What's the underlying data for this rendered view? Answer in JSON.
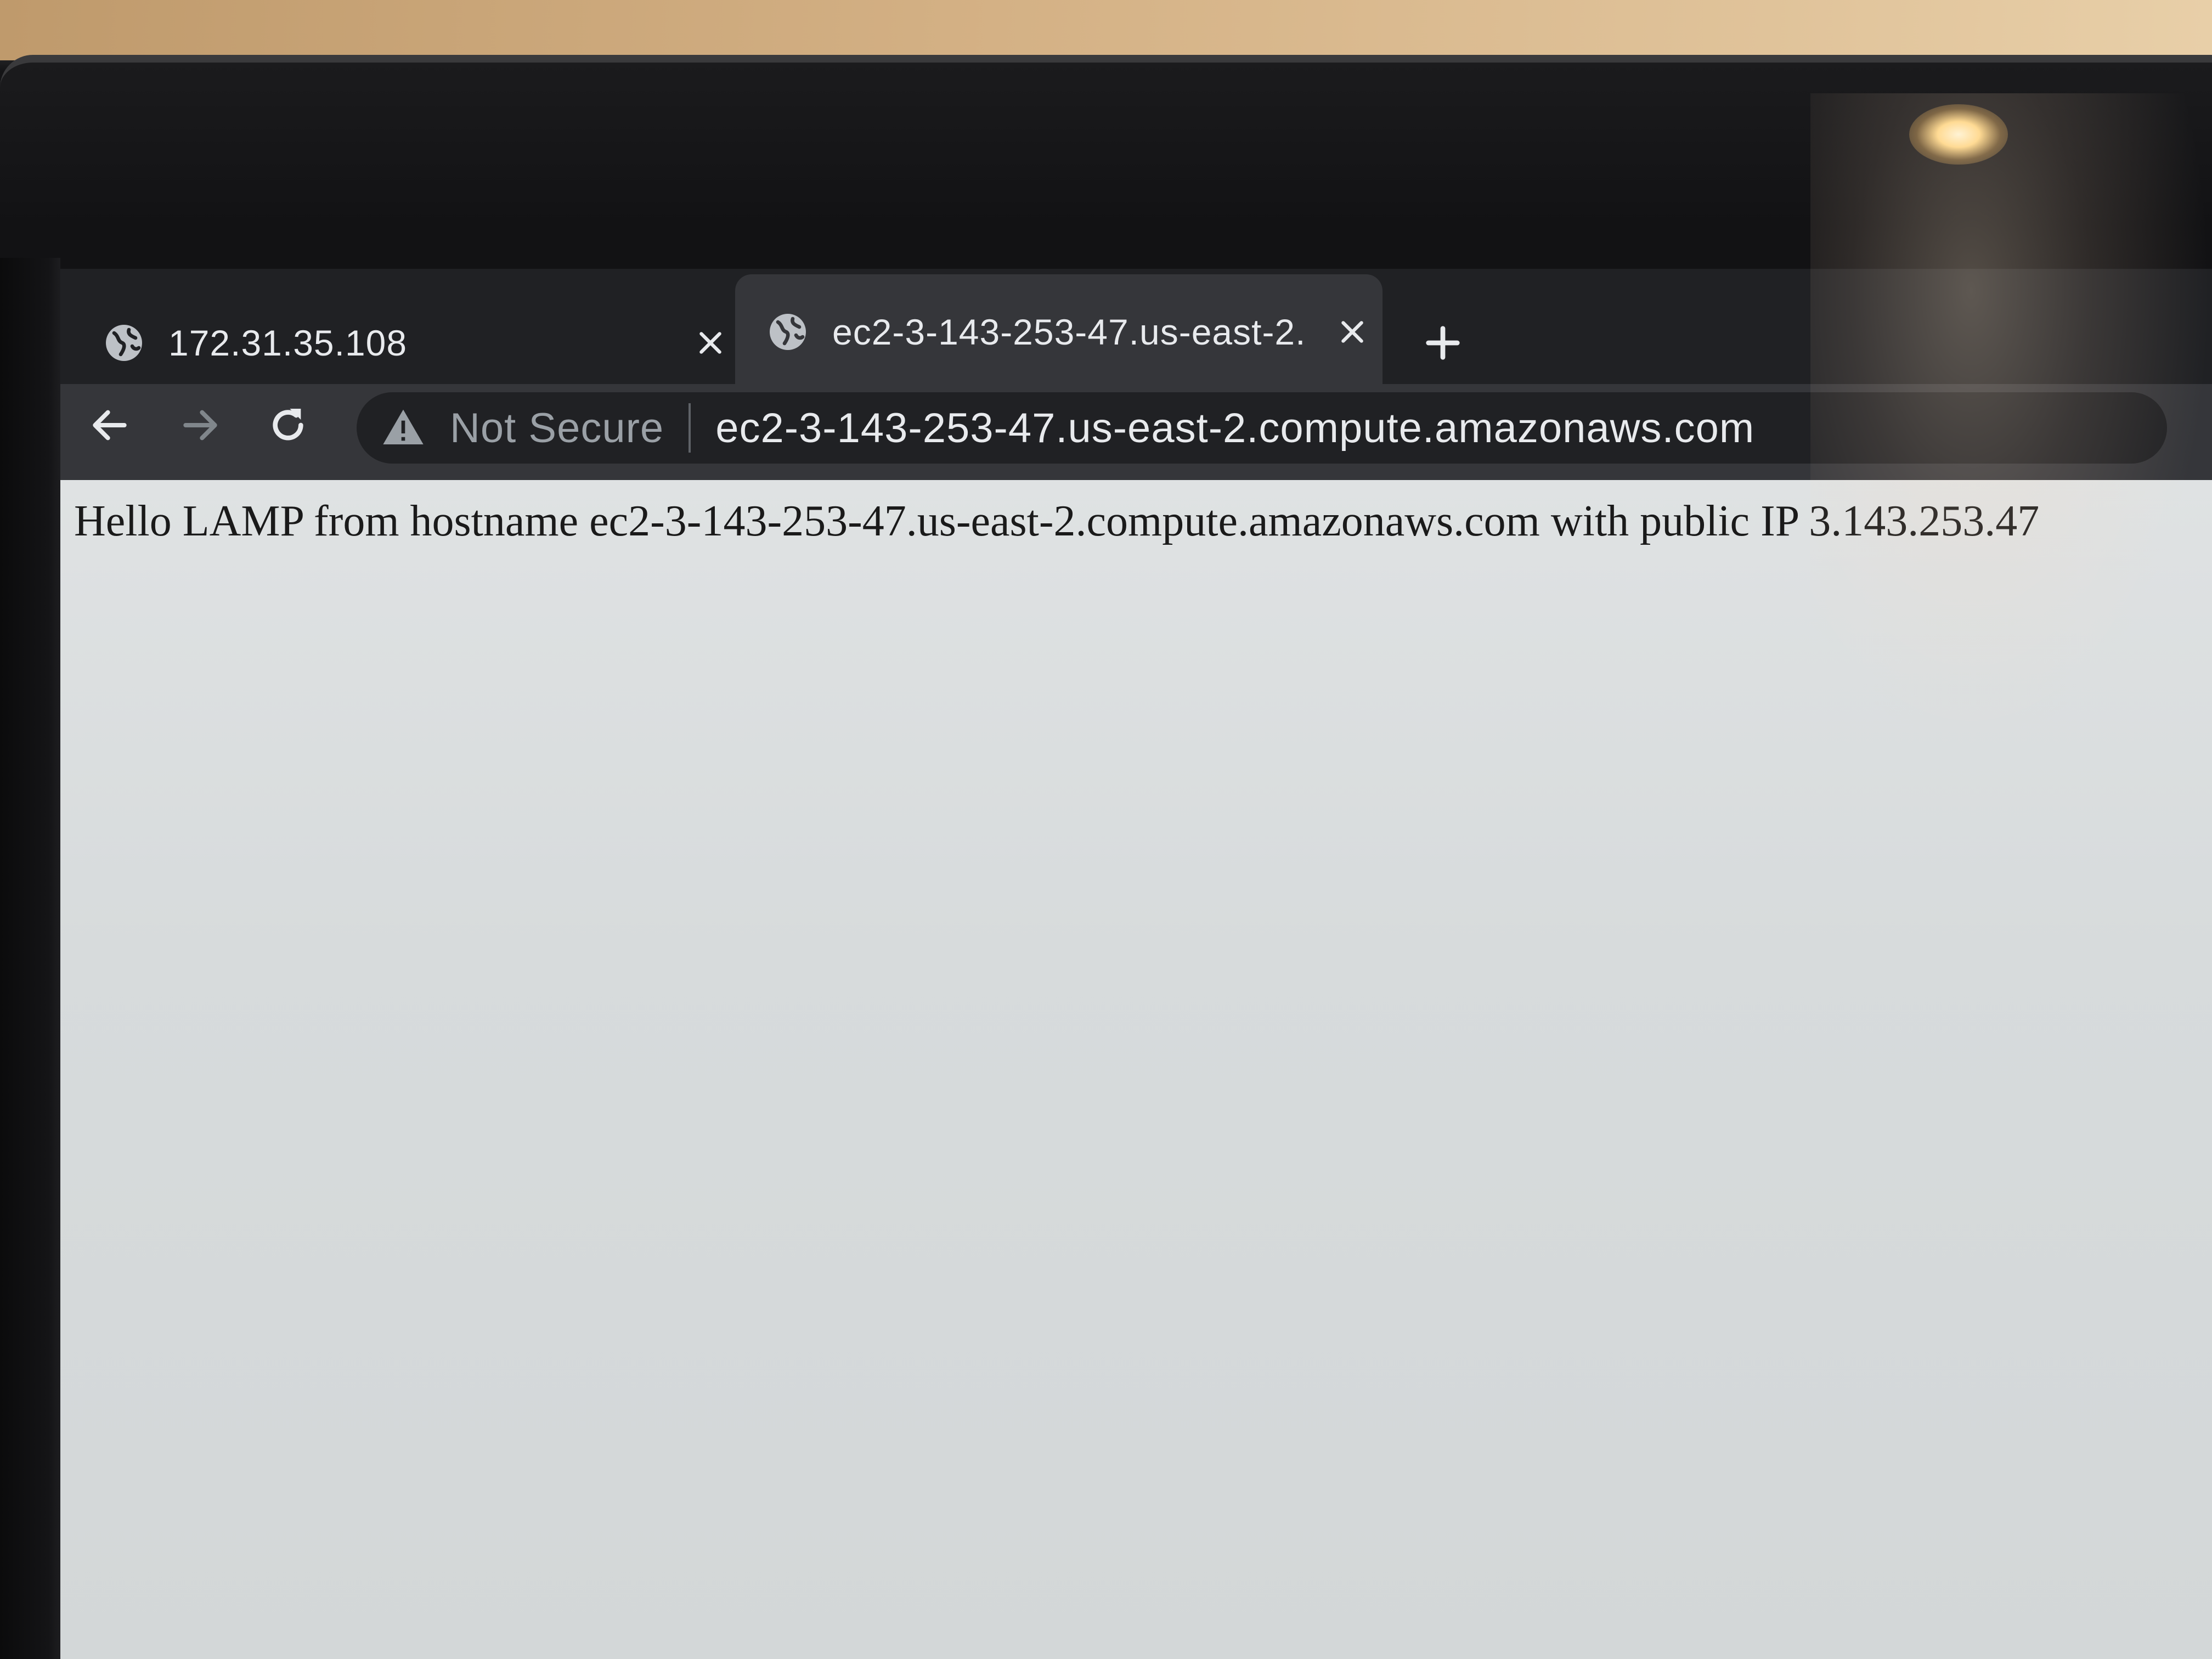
{
  "browser": {
    "tabs": [
      {
        "title": "172.31.35.108",
        "icon": "globe-icon",
        "active": false
      },
      {
        "title": "ec2-3-143-253-47.us-east-2.",
        "icon": "globe-icon",
        "active": true
      }
    ],
    "new_tab_icon": "plus-icon",
    "nav": {
      "back_icon": "arrow-left-icon",
      "forward_icon": "arrow-right-icon",
      "reload_icon": "reload-icon"
    },
    "omnibox": {
      "security_icon": "warning-icon",
      "security_label": "Not Secure",
      "url": "ec2-3-143-253-47.us-east-2.compute.amazonaws.com"
    }
  },
  "page": {
    "body_text": "Hello LAMP from hostname ec2-3-143-253-47.us-east-2.compute.amazonaws.com with public IP 3.143.253.47"
  },
  "colors": {
    "tab_strip": "#202124",
    "toolbar": "#35363a",
    "omnibox": "#202124",
    "page_background": "#dbdfe0"
  }
}
